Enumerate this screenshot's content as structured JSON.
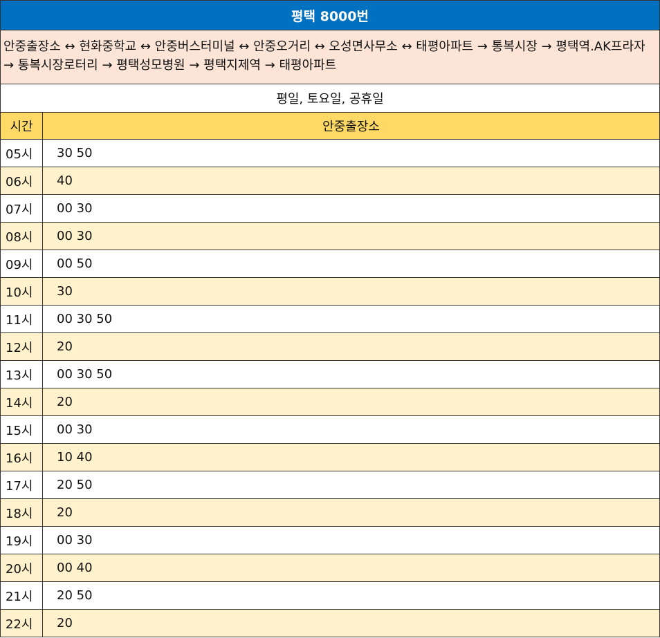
{
  "title": "평택 8000번",
  "route": "안중출장소 ↔ 현화중학교 ↔ 안중버스터미널 ↔ 안중오거리 ↔ 오성면사무소 ↔ 태평아파트 → 통복시장 → 평택역.AK프라자 → 통복시장로터리 → 평택성모병원 → 평택지제역 → 태평아파트",
  "service_days": "평일, 토요일, 공휴일",
  "headers": {
    "hour": "시간",
    "stop": "안중출장소"
  },
  "colors": {
    "title_bg": "#0070c0",
    "route_bg": "#fce4d6",
    "header_bg": "#ffd966",
    "alt_row_bg": "#fff2cc"
  },
  "rows": [
    {
      "hour": "05시",
      "times": "30 50"
    },
    {
      "hour": "06시",
      "times": "40"
    },
    {
      "hour": "07시",
      "times": "00 30"
    },
    {
      "hour": "08시",
      "times": "00 30"
    },
    {
      "hour": "09시",
      "times": "00 50"
    },
    {
      "hour": "10시",
      "times": "30"
    },
    {
      "hour": "11시",
      "times": "00 30 50"
    },
    {
      "hour": "12시",
      "times": "20"
    },
    {
      "hour": "13시",
      "times": "00 30 50"
    },
    {
      "hour": "14시",
      "times": "20"
    },
    {
      "hour": "15시",
      "times": "00 30"
    },
    {
      "hour": "16시",
      "times": "10 40"
    },
    {
      "hour": "17시",
      "times": "20 50"
    },
    {
      "hour": "18시",
      "times": "20"
    },
    {
      "hour": "19시",
      "times": "00 30"
    },
    {
      "hour": "20시",
      "times": "00 40"
    },
    {
      "hour": "21시",
      "times": "20 50"
    },
    {
      "hour": "22시",
      "times": "20"
    }
  ]
}
